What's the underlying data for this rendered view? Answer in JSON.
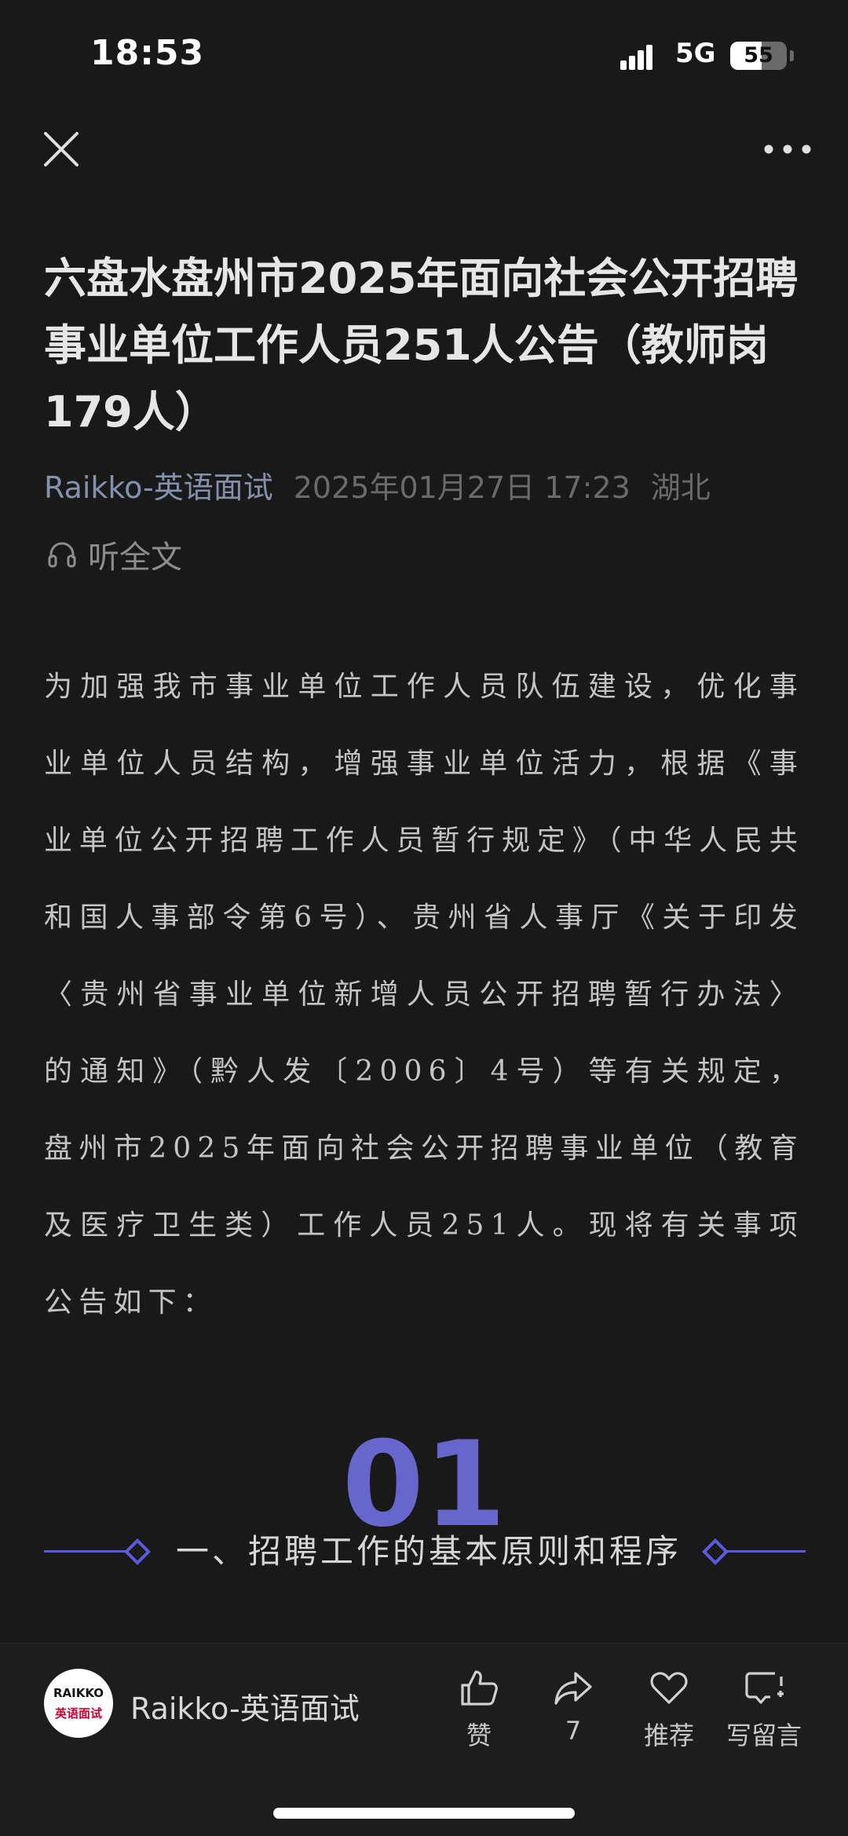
{
  "status_bar": {
    "time": "18:53",
    "network": "5G",
    "battery": "55",
    "battery_level": 0.55
  },
  "article": {
    "title": "六盘水盘州市2025年面向社会公开招聘事业单位工作人员251人公告（教师岗179人）",
    "author": "Raikko-英语面试",
    "date": "2025年01月27日 17:23",
    "region": "湖北",
    "listen_label": "听全文",
    "body": "为加强我市事业单位工作人员队伍建设，优化事业单位人员结构，增强事业单位活力，根据《事业单位公开招聘工作人员暂行规定》（中华人民共和国人事部令第6号）、贵州省人事厅《关于印发〈贵州省事业单位新增人员公开招聘暂行办法〉的通知》（黔人发〔2006〕4号）等有关规定，盘州市2025年面向社会公开招聘事业单位（教育及医疗卫生类）工作人员251人。现将有关事项公告如下：",
    "section": {
      "number": "01",
      "title": "一、招聘工作的基本原则和程序"
    }
  },
  "bottom_bar": {
    "avatar_line1": "RAIKKO",
    "avatar_line2": "英语面试",
    "account_name": "Raikko-英语面试",
    "actions": [
      {
        "icon": "thumbs-up-icon",
        "label": "赞"
      },
      {
        "icon": "share-icon",
        "label": "7"
      },
      {
        "icon": "heart-icon",
        "label": "推荐"
      },
      {
        "icon": "comment-add-icon",
        "label": "写留言"
      }
    ]
  },
  "colors": {
    "background": "#191919",
    "accent": "#5a5add",
    "author": "#8391ad"
  }
}
